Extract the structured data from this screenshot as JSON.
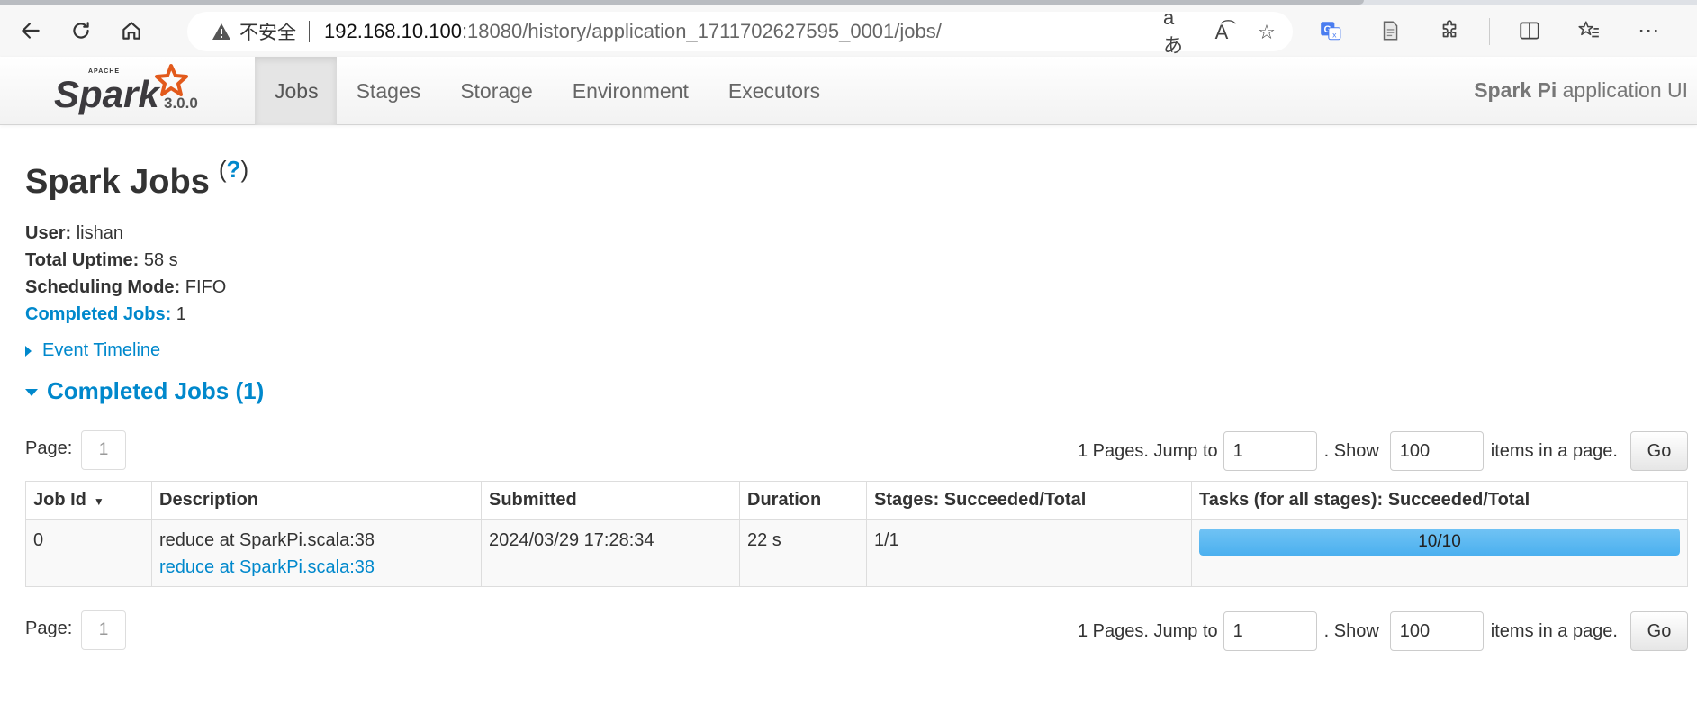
{
  "browser": {
    "insecure_label": "不安全",
    "url_host": "192.168.10.100",
    "url_rest": ":18080/history/application_1711702627595_0001/jobs/",
    "icons": [
      "back-icon",
      "refresh-icon",
      "home-icon",
      "warning-icon",
      "read-aloud-icon",
      "favorite-icon",
      "translate-icon",
      "reading-view-icon",
      "extensions-icon",
      "split-screen-icon",
      "favorites-list-icon",
      "more-icon"
    ]
  },
  "navbar": {
    "version": "3.0.0",
    "tabs": [
      {
        "label": "Jobs",
        "active": true
      },
      {
        "label": "Stages"
      },
      {
        "label": "Storage"
      },
      {
        "label": "Environment"
      },
      {
        "label": "Executors"
      }
    ],
    "app_name": "Spark Pi",
    "app_suffix": " application UI"
  },
  "page": {
    "title": "Spark Jobs",
    "help": "?",
    "summary": {
      "user_label": "User:",
      "user_value": " lishan",
      "uptime_label": "Total Uptime:",
      "uptime_value": " 58 s",
      "mode_label": "Scheduling Mode:",
      "mode_value": " FIFO",
      "completed_label": "Completed Jobs:",
      "completed_value": " 1"
    },
    "event_timeline": "Event Timeline",
    "completed_header": "Completed Jobs (1)"
  },
  "paging": {
    "page_label": "Page:",
    "page_current": "1",
    "pages_text": "1 Pages. Jump to",
    "jump_value": "1",
    "show_text": ". Show",
    "show_value": "100",
    "items_text": "items in a page.",
    "go_label": "Go"
  },
  "table": {
    "headers": [
      "Job Id",
      "Description",
      "Submitted",
      "Duration",
      "Stages: Succeeded/Total",
      "Tasks (for all stages): Succeeded/Total"
    ],
    "sort_arrow": "▼",
    "rows": [
      {
        "job_id": "0",
        "description": "reduce at SparkPi.scala:38",
        "description_link": "reduce at SparkPi.scala:38",
        "submitted": "2024/03/29 17:28:34",
        "duration": "22 s",
        "stages": "1/1",
        "tasks_text": "10/10",
        "tasks_fraction": 1.0
      }
    ]
  },
  "colors": {
    "link": "#0088cc",
    "progress": "#4bb0ef"
  }
}
